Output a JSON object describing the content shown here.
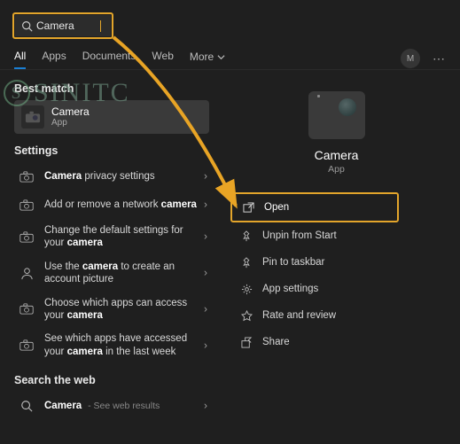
{
  "search": {
    "value": "Camera"
  },
  "tabs": {
    "all": "All",
    "apps": "Apps",
    "documents": "Documents",
    "web": "Web",
    "more": "More"
  },
  "user_initial": "M",
  "sections": {
    "best_match": "Best match",
    "settings": "Settings",
    "search_web": "Search the web"
  },
  "best_match": {
    "title": "Camera",
    "subtitle": "App"
  },
  "settings_items": [
    {
      "pre": "",
      "bold": "Camera",
      "post": " privacy settings"
    },
    {
      "pre": "Add or remove a network ",
      "bold": "camera",
      "post": ""
    },
    {
      "pre": "Change the default settings for your ",
      "bold": "camera",
      "post": ""
    },
    {
      "pre": "Use the ",
      "bold": "camera",
      "post": " to create an account picture"
    },
    {
      "pre": "Choose which apps can access your ",
      "bold": "camera",
      "post": ""
    },
    {
      "pre": "See which apps have accessed your ",
      "bold": "camera",
      "post": " in the last week"
    }
  ],
  "web_item": {
    "bold": "Camera",
    "sub": " - See web results"
  },
  "preview": {
    "name": "Camera",
    "type": "App"
  },
  "actions": {
    "open": "Open",
    "unpin": "Unpin from Start",
    "pin_taskbar": "Pin to taskbar",
    "app_settings": "App settings",
    "rate": "Rate and review",
    "share": "Share"
  },
  "watermark": "SINITC"
}
